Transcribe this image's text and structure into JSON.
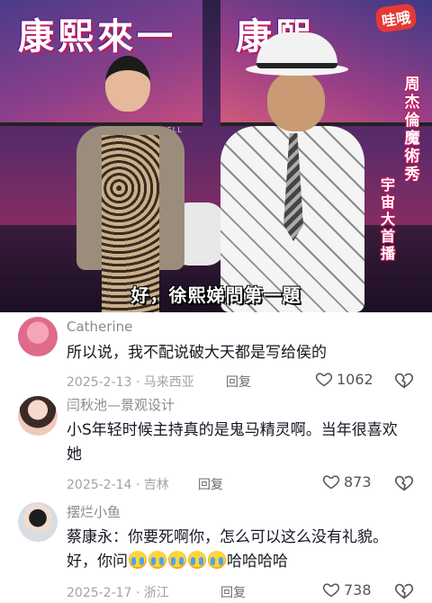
{
  "video": {
    "show_title_left": "康熙來一",
    "show_title_right": "康熙",
    "badge": "哇哦",
    "vertical_caption": "周杰倫魔術秀",
    "vertical_caption_2": "宇宙大首播",
    "studio_brand": "ZINWELL",
    "subtitle": "好，徐熙娣問第一題"
  },
  "comments": [
    {
      "username": "Catherine",
      "text": "所以说，我不配说破大天都是写给侯的",
      "date_location": "2025-2-13 · 马来西亚",
      "reply_label": "回复",
      "likes": "1062",
      "avatar_color": "#e06a8a"
    },
    {
      "username": "闫秋池—景观设计",
      "text": "小S年轻时候主持真的是鬼马精灵啊。当年很喜欢她",
      "date_location": "2025-2-14 · 吉林",
      "reply_label": "回复",
      "likes": "873",
      "avatar_color": "#f1c9b8"
    },
    {
      "username": "摆烂小鱼",
      "text_line1": "蔡康永：你要死啊你，怎么可以这么没有礼貌。",
      "text_line2_prefix": "好，你问",
      "text_line2_suffix": "哈哈哈哈",
      "emoji_name": "loudly-crying-face",
      "date_location": "2025-2-17 · 浙江",
      "reply_label": "回复",
      "likes": "738",
      "avatar_color": "#d7dde3"
    }
  ]
}
